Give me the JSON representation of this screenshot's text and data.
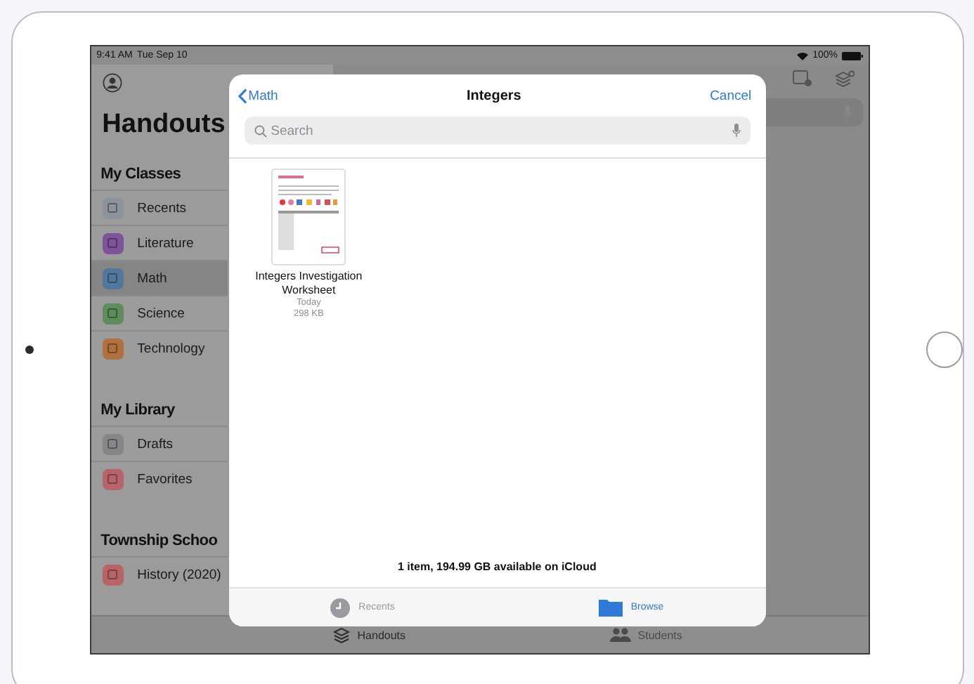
{
  "status_bar": {
    "time": "9:41 AM",
    "date": "Tue Sep 10",
    "battery": "100%"
  },
  "sidebar": {
    "title": "Handouts",
    "sections": [
      {
        "title": "My Classes",
        "items": [
          {
            "label": "Recents",
            "color": "#8d939c",
            "selected": false
          },
          {
            "label": "Literature",
            "color": "#7d5499",
            "selected": false
          },
          {
            "label": "Math",
            "color": "#52779f",
            "selected": true
          },
          {
            "label": "Science",
            "color": "#5f8c5b",
            "selected": false
          },
          {
            "label": "Technology",
            "color": "#b0713f",
            "selected": false
          }
        ]
      },
      {
        "title": "My Library",
        "items": [
          {
            "label": "Drafts",
            "color": "#86868a",
            "selected": false
          },
          {
            "label": "Favorites",
            "color": "#b8646c",
            "selected": false
          }
        ]
      },
      {
        "title": "Township Schoo",
        "items": [
          {
            "label": "History (2020)",
            "color": "#b86466",
            "selected": false
          }
        ]
      }
    ]
  },
  "bottom_tabs": [
    {
      "label": "Handouts",
      "selected": true
    },
    {
      "label": "Students",
      "selected": false
    }
  ],
  "picker": {
    "back": "Math",
    "title": "Integers",
    "cancel": "Cancel",
    "search": {
      "placeholder": "Search"
    },
    "files": [
      {
        "name": "Integers Investigation Worksheet",
        "date": "Today",
        "size": "298 KB"
      }
    ],
    "summary": "1 item, 194.99 GB available on iCloud",
    "tabs": [
      {
        "label": "Recents",
        "selected": false
      },
      {
        "label": "Browse",
        "selected": true
      }
    ]
  }
}
